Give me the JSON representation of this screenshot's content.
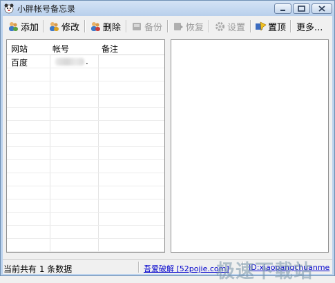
{
  "window": {
    "title": "小胖帐号备忘录"
  },
  "toolbar": {
    "add_label": "添加",
    "edit_label": "修改",
    "delete_label": "删除",
    "backup_label": "备份",
    "restore_label": "恢复",
    "settings_label": "设置",
    "top_label": "置顶",
    "more_label": "更多..."
  },
  "table": {
    "columns": [
      "网站",
      "帐号",
      "备注"
    ],
    "rows": [
      {
        "site": "百度",
        "account_suffix": ".",
        "note": ""
      }
    ]
  },
  "status": {
    "count_text": "当前共有 1 条数据",
    "link1": "吾爱破解 [52pojie.com]",
    "link2": "ID:xiaopangchuanme"
  },
  "watermark": {
    "text": "极速下载站"
  },
  "colors": {
    "title_bg": "#c3d8f0",
    "link": "#0000cc"
  }
}
